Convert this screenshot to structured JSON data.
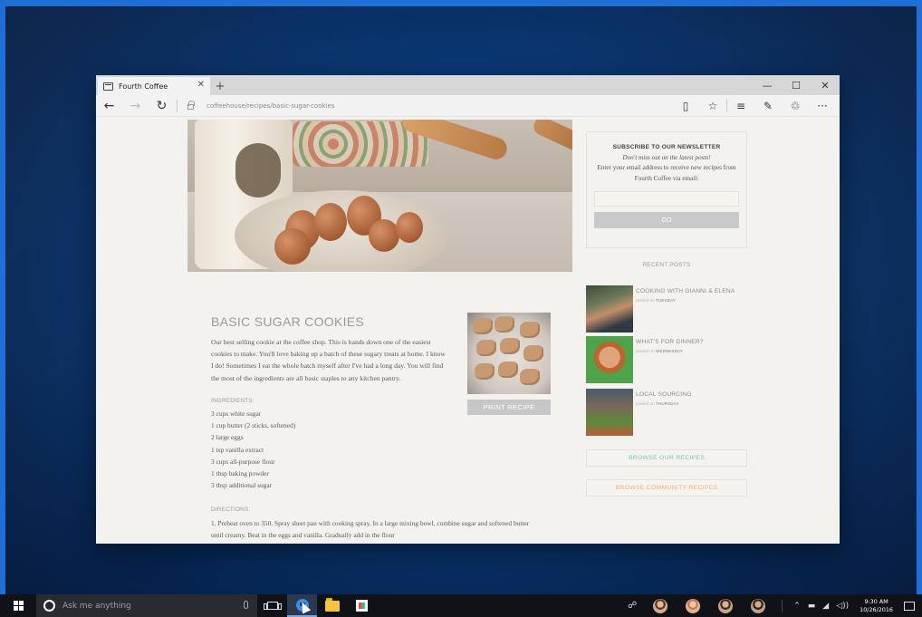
{
  "browser": {
    "tab_title": "Fourth Coffee",
    "address": "coffeehouse/recipes/basic-sugar-cookies"
  },
  "article": {
    "title": "BASIC SUGAR COOKIES",
    "intro": "Our best selling cookie at the coffee shop. This is hands down one of the easiest cookies to make. You'll love baking up a batch of these sugary treats at home. I know I do! Sometimes I eat the whole batch myself after I've had a long day. You will find the most of the ingredients are all basic staples to any kitchen pantry.",
    "ingredients_label": "INGREDIENTS:",
    "ingredients": [
      "3 cups white sugar",
      "1 cup butter (2 sticks, softened)",
      "2 large eggs",
      "1 tsp vanilla extract",
      "3 cups all-purpose flour",
      "1 tbsp baking powder",
      "3 tbsp additional sugar"
    ],
    "directions_label": "DIRECTIONS:",
    "directions": "1.  Preheat oven to 350. Spray sheet pan with cooking spray. In a large mixing bowl, combine sugar and softened butter until creamy. Beat in the eggs and vanilla. Gradually add in the flour",
    "print_label": "PRINT RECIPE"
  },
  "newsletter": {
    "heading": "SUBSCRIBE TO OUR NEWSLETTER",
    "tagline": "Don't miss out on the latest posts!",
    "description": "Enter your email address to receive new recipes from Fourth Coffee via email:",
    "email_placeholder": "",
    "go_label": "GO"
  },
  "recent_posts": {
    "heading": "RECENT POSTS",
    "posted_on": "posted on",
    "items": [
      {
        "title": "COOKING WITH GIANNI & ELENA",
        "day": "TUESDAY"
      },
      {
        "title": "WHAT'S FOR DINNER?",
        "day": "WEDNESDAY"
      },
      {
        "title": "LOCAL SOURCING",
        "day": "THURSDAY"
      }
    ]
  },
  "sidebar_buttons": {
    "browse_recipes": "BROWSE OUR RECIPES",
    "browse_community": "BROWSE COMMUNITY RECIPES",
    "browse_recipes_color": "#7fc79a",
    "browse_community_color": "#f2b07a"
  },
  "taskbar": {
    "search_placeholder": "Ask me anything",
    "time": "9:30 AM",
    "date": "10/26/2016"
  }
}
